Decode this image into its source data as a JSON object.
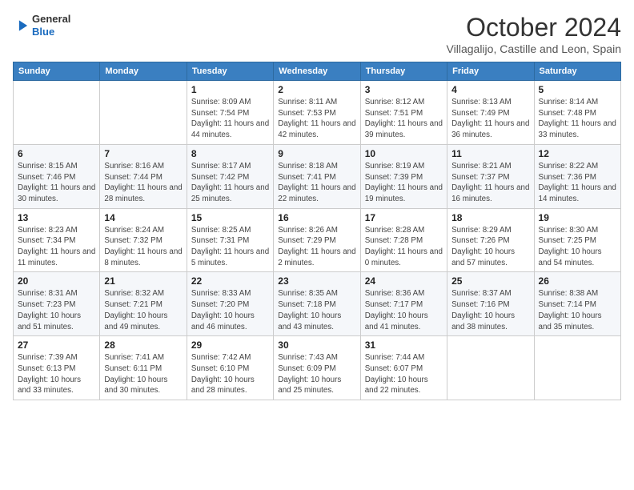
{
  "header": {
    "logo": {
      "general": "General",
      "blue": "Blue"
    },
    "month": "October 2024",
    "location": "Villagalijo, Castille and Leon, Spain"
  },
  "weekdays": [
    "Sunday",
    "Monday",
    "Tuesday",
    "Wednesday",
    "Thursday",
    "Friday",
    "Saturday"
  ],
  "weeks": [
    [
      {
        "day": "",
        "info": ""
      },
      {
        "day": "",
        "info": ""
      },
      {
        "day": "1",
        "info": "Sunrise: 8:09 AM\nSunset: 7:54 PM\nDaylight: 11 hours and 44 minutes."
      },
      {
        "day": "2",
        "info": "Sunrise: 8:11 AM\nSunset: 7:53 PM\nDaylight: 11 hours and 42 minutes."
      },
      {
        "day": "3",
        "info": "Sunrise: 8:12 AM\nSunset: 7:51 PM\nDaylight: 11 hours and 39 minutes."
      },
      {
        "day": "4",
        "info": "Sunrise: 8:13 AM\nSunset: 7:49 PM\nDaylight: 11 hours and 36 minutes."
      },
      {
        "day": "5",
        "info": "Sunrise: 8:14 AM\nSunset: 7:48 PM\nDaylight: 11 hours and 33 minutes."
      }
    ],
    [
      {
        "day": "6",
        "info": "Sunrise: 8:15 AM\nSunset: 7:46 PM\nDaylight: 11 hours and 30 minutes."
      },
      {
        "day": "7",
        "info": "Sunrise: 8:16 AM\nSunset: 7:44 PM\nDaylight: 11 hours and 28 minutes."
      },
      {
        "day": "8",
        "info": "Sunrise: 8:17 AM\nSunset: 7:42 PM\nDaylight: 11 hours and 25 minutes."
      },
      {
        "day": "9",
        "info": "Sunrise: 8:18 AM\nSunset: 7:41 PM\nDaylight: 11 hours and 22 minutes."
      },
      {
        "day": "10",
        "info": "Sunrise: 8:19 AM\nSunset: 7:39 PM\nDaylight: 11 hours and 19 minutes."
      },
      {
        "day": "11",
        "info": "Sunrise: 8:21 AM\nSunset: 7:37 PM\nDaylight: 11 hours and 16 minutes."
      },
      {
        "day": "12",
        "info": "Sunrise: 8:22 AM\nSunset: 7:36 PM\nDaylight: 11 hours and 14 minutes."
      }
    ],
    [
      {
        "day": "13",
        "info": "Sunrise: 8:23 AM\nSunset: 7:34 PM\nDaylight: 11 hours and 11 minutes."
      },
      {
        "day": "14",
        "info": "Sunrise: 8:24 AM\nSunset: 7:32 PM\nDaylight: 11 hours and 8 minutes."
      },
      {
        "day": "15",
        "info": "Sunrise: 8:25 AM\nSunset: 7:31 PM\nDaylight: 11 hours and 5 minutes."
      },
      {
        "day": "16",
        "info": "Sunrise: 8:26 AM\nSunset: 7:29 PM\nDaylight: 11 hours and 2 minutes."
      },
      {
        "day": "17",
        "info": "Sunrise: 8:28 AM\nSunset: 7:28 PM\nDaylight: 11 hours and 0 minutes."
      },
      {
        "day": "18",
        "info": "Sunrise: 8:29 AM\nSunset: 7:26 PM\nDaylight: 10 hours and 57 minutes."
      },
      {
        "day": "19",
        "info": "Sunrise: 8:30 AM\nSunset: 7:25 PM\nDaylight: 10 hours and 54 minutes."
      }
    ],
    [
      {
        "day": "20",
        "info": "Sunrise: 8:31 AM\nSunset: 7:23 PM\nDaylight: 10 hours and 51 minutes."
      },
      {
        "day": "21",
        "info": "Sunrise: 8:32 AM\nSunset: 7:21 PM\nDaylight: 10 hours and 49 minutes."
      },
      {
        "day": "22",
        "info": "Sunrise: 8:33 AM\nSunset: 7:20 PM\nDaylight: 10 hours and 46 minutes."
      },
      {
        "day": "23",
        "info": "Sunrise: 8:35 AM\nSunset: 7:18 PM\nDaylight: 10 hours and 43 minutes."
      },
      {
        "day": "24",
        "info": "Sunrise: 8:36 AM\nSunset: 7:17 PM\nDaylight: 10 hours and 41 minutes."
      },
      {
        "day": "25",
        "info": "Sunrise: 8:37 AM\nSunset: 7:16 PM\nDaylight: 10 hours and 38 minutes."
      },
      {
        "day": "26",
        "info": "Sunrise: 8:38 AM\nSunset: 7:14 PM\nDaylight: 10 hours and 35 minutes."
      }
    ],
    [
      {
        "day": "27",
        "info": "Sunrise: 7:39 AM\nSunset: 6:13 PM\nDaylight: 10 hours and 33 minutes."
      },
      {
        "day": "28",
        "info": "Sunrise: 7:41 AM\nSunset: 6:11 PM\nDaylight: 10 hours and 30 minutes."
      },
      {
        "day": "29",
        "info": "Sunrise: 7:42 AM\nSunset: 6:10 PM\nDaylight: 10 hours and 28 minutes."
      },
      {
        "day": "30",
        "info": "Sunrise: 7:43 AM\nSunset: 6:09 PM\nDaylight: 10 hours and 25 minutes."
      },
      {
        "day": "31",
        "info": "Sunrise: 7:44 AM\nSunset: 6:07 PM\nDaylight: 10 hours and 22 minutes."
      },
      {
        "day": "",
        "info": ""
      },
      {
        "day": "",
        "info": ""
      }
    ]
  ]
}
